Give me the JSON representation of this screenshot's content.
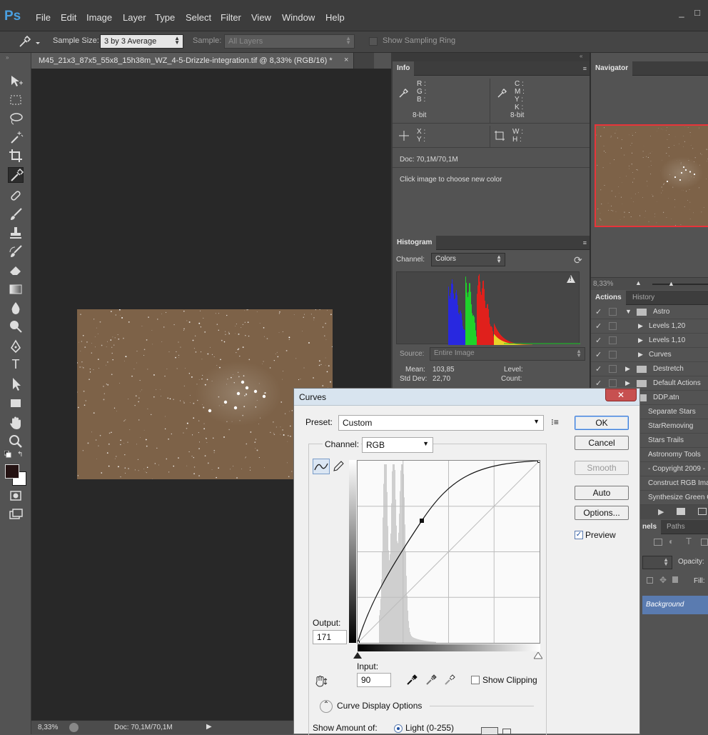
{
  "menubar": {
    "logo": "Ps",
    "items": [
      "File",
      "Edit",
      "Image",
      "Layer",
      "Type",
      "Select",
      "Filter",
      "View",
      "Window",
      "Help"
    ],
    "window_controls": [
      "_",
      "□"
    ]
  },
  "options": {
    "sample_size_label": "Sample Size:",
    "sample_size_value": "3 by 3 Average",
    "sample_label": "Sample:",
    "sample_value": "All Layers",
    "show_ring_label": "Show Sampling Ring"
  },
  "document": {
    "tab_title": "M45_21x3_87x5_55x8_15h38m_WZ_4-5-Drizzle-integration.tif @ 8,33% (RGB/16) *",
    "close": "×",
    "zoom": "8,33%",
    "doc_status": "Doc: 70,1M/70,1M"
  },
  "info_panel": {
    "tab": "Info",
    "rgb_labels": [
      "R :",
      "G :",
      "B :"
    ],
    "cmyk_labels": [
      "C :",
      "M :",
      "Y :",
      "K :"
    ],
    "bit_left": "8-bit",
    "bit_right": "8-bit",
    "xy_labels": [
      "X :",
      "Y :"
    ],
    "wh_labels": [
      "W :",
      "H :"
    ],
    "doc": "Doc: 70,1M/70,1M",
    "hint": "Click image to choose new color"
  },
  "navigator": {
    "tab": "Navigator",
    "zoom": "8,33%"
  },
  "histogram": {
    "tab": "Histogram",
    "channel_label": "Channel:",
    "channel_value": "Colors",
    "source_label": "Source:",
    "source_value": "Entire Image",
    "mean_label": "Mean:",
    "mean_value": "103,85",
    "stddev_label": "Std Dev:",
    "stddev_value": "22,70",
    "level_label": "Level:",
    "count_label": "Count:",
    "warning": "!"
  },
  "actions": {
    "tabs": [
      "Actions",
      "History"
    ],
    "rows": [
      {
        "label": "Astro",
        "indent": 0,
        "type": "set",
        "open": true
      },
      {
        "label": "Levels 1,20",
        "indent": 1,
        "type": "action"
      },
      {
        "label": "Levels 1,10",
        "indent": 1,
        "type": "action"
      },
      {
        "label": "Curves",
        "indent": 1,
        "type": "action"
      },
      {
        "label": "Destretch",
        "indent": 0,
        "type": "set"
      },
      {
        "label": "Default Actions",
        "indent": 0,
        "type": "set"
      },
      {
        "label": "DDP.atn",
        "indent": 0,
        "type": "set"
      },
      {
        "label": "Separate Stars",
        "indent": 0,
        "type": "set"
      },
      {
        "label": "StarRemoving",
        "indent": 0,
        "type": "set"
      },
      {
        "label": "Stars Trails",
        "indent": 0,
        "type": "set"
      },
      {
        "label": "Astronomy Tools",
        "indent": 0,
        "type": "set"
      },
      {
        "label": "- Copyright 2009 -",
        "indent": 0,
        "type": "set"
      },
      {
        "label": "Construct RGB Ima",
        "indent": 0,
        "type": "set"
      },
      {
        "label": "Synthesize Green C",
        "indent": 0,
        "type": "set"
      }
    ]
  },
  "layers": {
    "tabs": [
      "nels",
      "Paths"
    ],
    "opacity_label": "Opacity:",
    "fill_label": "Fill:",
    "layer_name": "Background"
  },
  "curves": {
    "title": "Curves",
    "close": "✕",
    "preset_label": "Preset:",
    "preset_value": "Custom",
    "channel_label": "Channel:",
    "channel_value": "RGB",
    "output_label": "Output:",
    "output_value": "171",
    "input_label": "Input:",
    "input_value": "90",
    "show_clipping": "Show Clipping",
    "display_options": "Curve Display Options",
    "show_amount": "Show Amount of:",
    "light_option": "Light  (0-255)",
    "buttons": {
      "ok": "OK",
      "cancel": "Cancel",
      "smooth": "Smooth",
      "auto": "Auto",
      "options": "Options..."
    },
    "preview_label": "Preview",
    "preview_checked": true,
    "curve_points": [
      [
        0,
        0
      ],
      [
        90,
        171
      ],
      [
        255,
        255
      ]
    ]
  },
  "colors": {
    "accent": "#4a9fe0",
    "image_bg": "#7d6248",
    "hist_red": "#e0201c",
    "hist_green": "#1fd22a",
    "hist_blue": "#2828e0",
    "nav_frame": "#e8343a"
  }
}
